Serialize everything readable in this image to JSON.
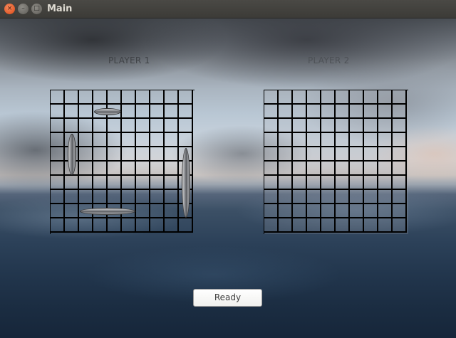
{
  "window": {
    "title": "Main",
    "buttons": {
      "close": "×",
      "minimize": "–",
      "maximize": "□"
    }
  },
  "players": [
    {
      "label": "PLAYER 1"
    },
    {
      "label": "PLAYER 2"
    }
  ],
  "boards": {
    "rows": 10,
    "cols": 10,
    "player1_ships": [
      {
        "name": "ship-horizontal-top",
        "orientation": "horizontal",
        "row": 1,
        "col": 3,
        "length": 2
      },
      {
        "name": "ship-vertical-left",
        "orientation": "vertical",
        "row": 3,
        "col": 1,
        "length": 3
      },
      {
        "name": "ship-vertical-right",
        "orientation": "vertical",
        "row": 4,
        "col": 9,
        "length": 5
      },
      {
        "name": "ship-horizontal-bottom",
        "orientation": "horizontal",
        "row": 8,
        "col": 2,
        "length": 4
      }
    ]
  },
  "controls": {
    "ready_label": "Ready"
  },
  "colors": {
    "titlebar": "#3c3b37",
    "close_button": "#dd4814",
    "grid_line": "#000000"
  }
}
